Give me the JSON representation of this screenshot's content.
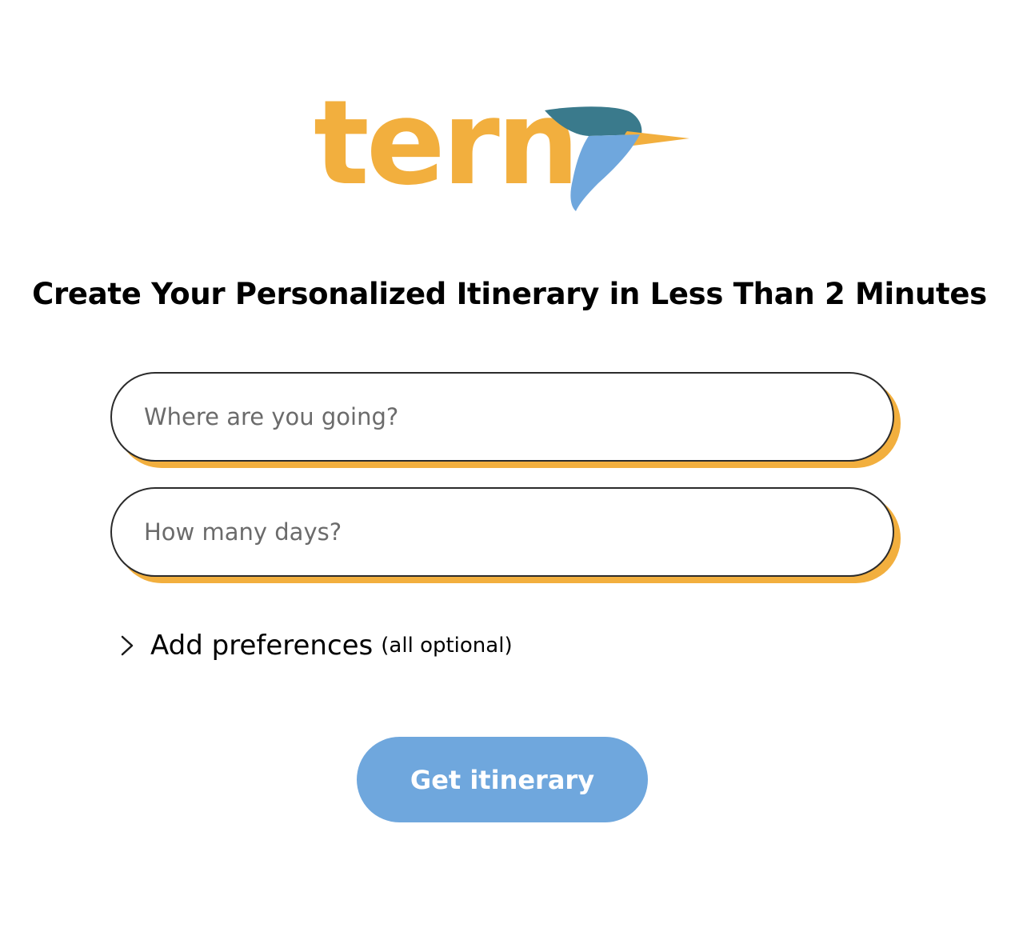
{
  "brand": {
    "name": "tern",
    "logo_icon": "tern-bird-icon",
    "colors": {
      "wordmark": "#F2AF3E",
      "bird_head": "#3A7A8C",
      "bird_body": "#6FA7DD",
      "beak": "#F2AF3E"
    }
  },
  "headline": "Create Your Personalized Itinerary in Less Than 2 Minutes",
  "form": {
    "destination": {
      "placeholder": "Where are you going?",
      "value": ""
    },
    "days": {
      "placeholder": "How many days?",
      "value": ""
    },
    "field_shadow_color": "#F2AF3E"
  },
  "preferences": {
    "icon": "chevron-right-icon",
    "label": "Add preferences",
    "note": "(all optional)"
  },
  "submit": {
    "label": "Get itinerary",
    "color": "#6FA7DD"
  }
}
